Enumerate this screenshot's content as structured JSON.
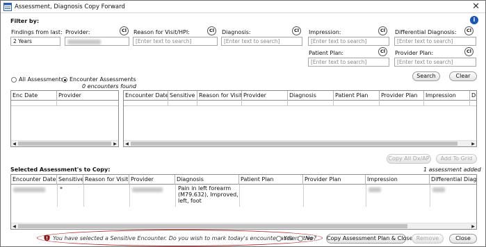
{
  "window": {
    "title": "Assessment, Diagnosis Copy Forward"
  },
  "filter": {
    "heading": "Filter by:",
    "findings_label": "Findings from last:",
    "findings_value": "2 Years",
    "provider_label": "Provider:",
    "reason_label": "Reason for Visit/HPI:",
    "diagnosis_label": "Diagnosis:",
    "impression_label": "Impression:",
    "differential_label": "Differential Diagnosis:",
    "patient_plan_label": "Patient Plan:",
    "provider_plan_label": "Provider Plan:",
    "placeholder": "[Enter text to search]",
    "cl_label": "Cl",
    "search_button": "Search",
    "clear_button": "Clear"
  },
  "mode": {
    "all_label": "All Assessments",
    "encounter_label": "Encounter Assessments",
    "selected": "encounter",
    "count_text": "0 encounters found"
  },
  "left_grid": {
    "columns": [
      "Enc Date",
      "Provider"
    ]
  },
  "right_grid": {
    "columns": [
      "Encounter Date",
      "Sensitive",
      "Reason for Visit",
      "Provider",
      "Diagnosis",
      "Patient Plan",
      "Provider Plan",
      "Impression",
      "Diff Dia"
    ]
  },
  "actions": {
    "copy_all": "Copy All Dx/AP",
    "add_to_grid": "Add To Grid"
  },
  "selected": {
    "heading": "Selected Assessment's to Copy:",
    "count_text": "1 assessment added",
    "columns": [
      "Encounter Date",
      "Sensitive",
      "Reason for Visit",
      "Provider",
      "Diagnosis",
      "Patient Plan",
      "Provider Plan",
      "Impression",
      "Differential Diagno"
    ],
    "rows": [
      {
        "sensitive": "*",
        "diagnosis": [
          "Pain in left forearm",
          "(M79.632), Improved,",
          "left, foot"
        ]
      }
    ]
  },
  "footer": {
    "message": "You have selected a Sensitive Encounter. Do you wish to mark today's encounter as Sensitive?",
    "yes_label": "Yes",
    "no_label": "No",
    "copy_button": "Copy Assessment Plan & Close",
    "remove_button": "Remove",
    "close_button": "Close"
  },
  "colors": {
    "warning_oval": "#b22a2a",
    "info_icon": "#1d55b3"
  }
}
